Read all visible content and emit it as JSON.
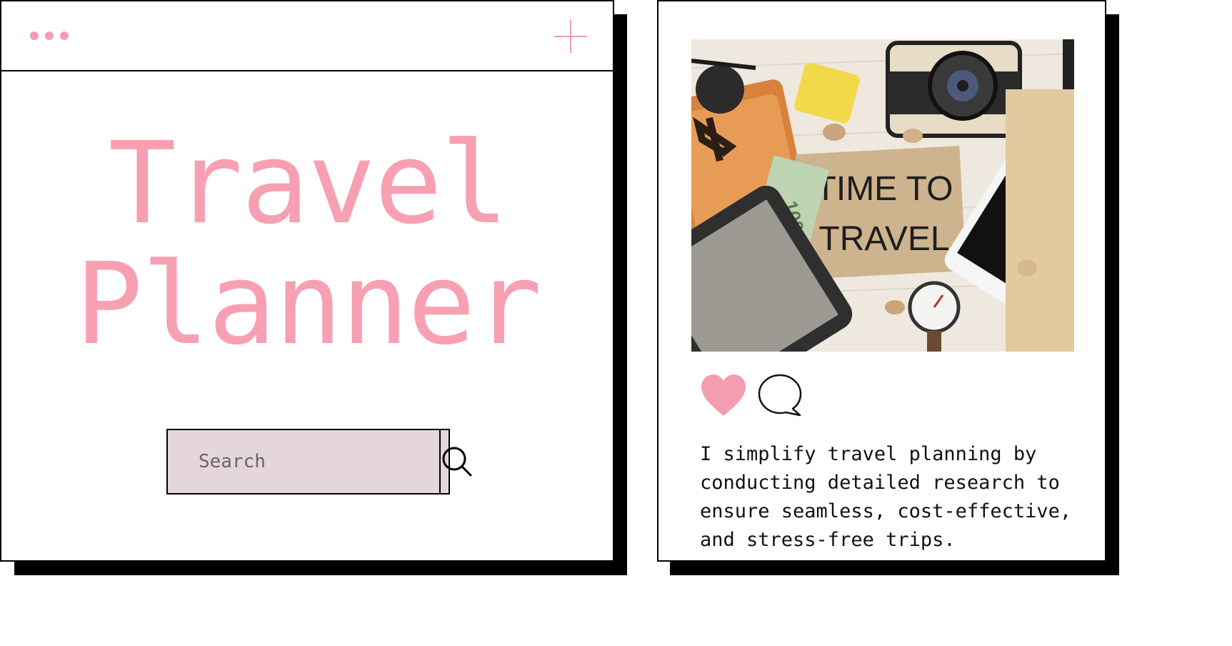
{
  "left_panel": {
    "title_line1": "Travel",
    "title_line2": "Planner",
    "search": {
      "placeholder": "Search"
    },
    "accent_color": "#f7a0b2"
  },
  "right_panel": {
    "photo": {
      "sign_line1": "TIME TO",
      "sign_line2": "TRAVEL",
      "banknote": "100"
    },
    "caption": "I simplify travel planning by conducting detailed research to ensure seamless, cost-effective, and stress-free trips."
  },
  "icons": [
    "dots-icon",
    "plus-icon",
    "search-icon",
    "heart-icon",
    "comment-icon"
  ]
}
